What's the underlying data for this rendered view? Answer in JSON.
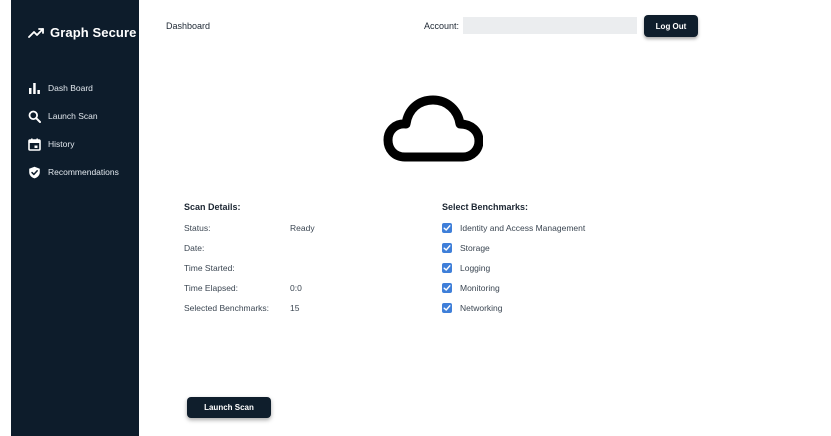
{
  "sidebar": {
    "brand": "Graph Secure",
    "brand_icon": "trending-up-icon",
    "items": [
      {
        "label": "Dash Board",
        "icon": "bar-chart-icon"
      },
      {
        "label": "Launch Scan",
        "icon": "search-icon"
      },
      {
        "label": "History",
        "icon": "calendar-icon"
      },
      {
        "label": "Recommendations",
        "icon": "shield-check-icon"
      }
    ]
  },
  "header": {
    "title": "Dashboard",
    "account_label": "Account:",
    "account_value": "",
    "logout_label": "Log Out"
  },
  "main": {
    "cloud_icon": "cloud-icon",
    "scan_details": {
      "title": "Scan Details:",
      "rows": [
        {
          "label": "Status:",
          "value": "Ready"
        },
        {
          "label": "Date:",
          "value": ""
        },
        {
          "label": "Time Started:",
          "value": ""
        },
        {
          "label": "Time Elapsed:",
          "value": "0:0"
        },
        {
          "label": "Selected Benchmarks:",
          "value": "15"
        }
      ]
    },
    "benchmarks": {
      "title": "Select Benchmarks:",
      "items": [
        {
          "label": "Identity and Access Management",
          "checked": true
        },
        {
          "label": "Storage",
          "checked": true
        },
        {
          "label": "Logging",
          "checked": true
        },
        {
          "label": "Monitoring",
          "checked": true
        },
        {
          "label": "Networking",
          "checked": true
        }
      ]
    },
    "launch_label": "Launch Scan"
  },
  "colors": {
    "sidebar_bg": "#0d1c2b",
    "button_bg": "#0f1e2c",
    "checkbox": "#3f7fd9"
  }
}
